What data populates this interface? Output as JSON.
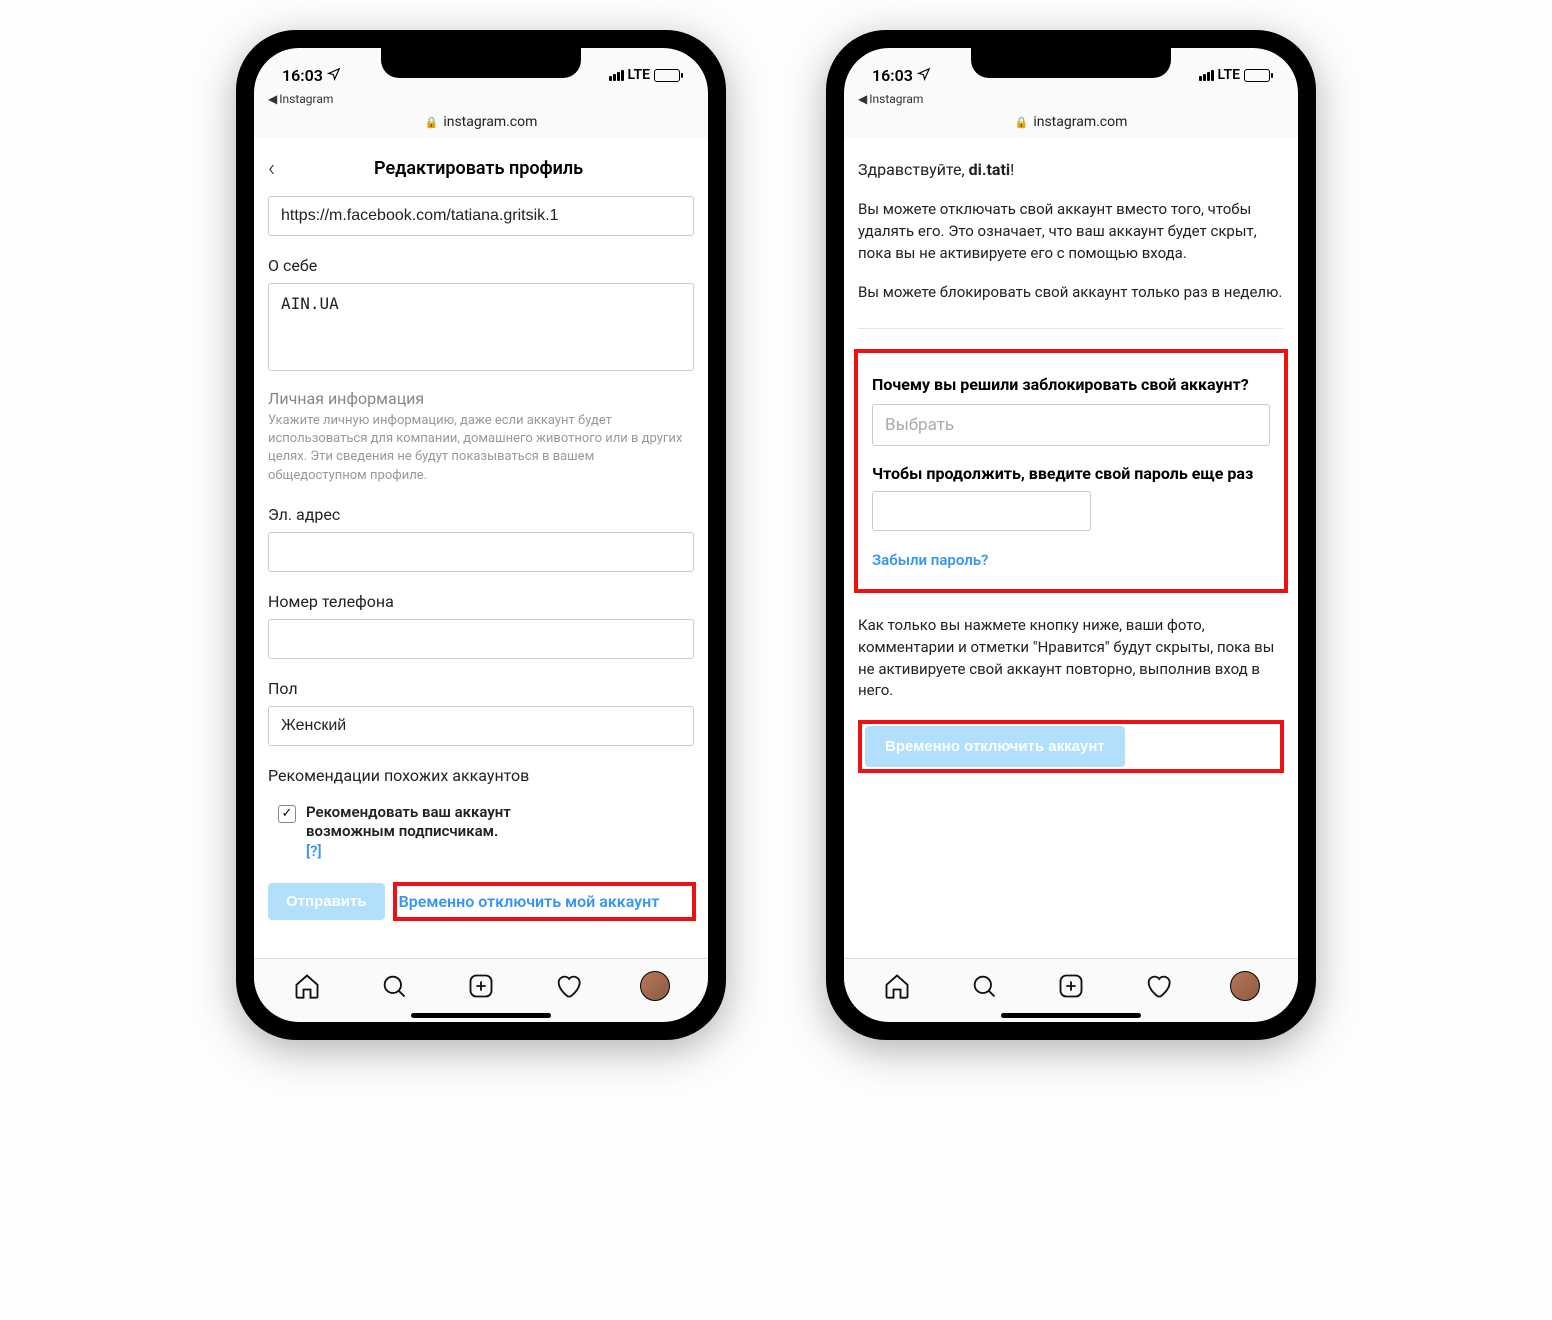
{
  "status": {
    "time": "16:03",
    "back_app": "Instagram",
    "carrier": "LTE",
    "url_host": "instagram.com"
  },
  "left": {
    "title": "Редактировать профиль",
    "website_value": "https://m.facebook.com/tatiana.gritsik.1",
    "bio_label": "О себе",
    "bio_value": "AIN.UA",
    "personal_title": "Личная информация",
    "personal_desc": "Укажите личную информацию, даже если аккаунт будет использоваться для компании, домашнего животного или в других целях. Эти сведения не будут показываться в вашем общедоступном профиле.",
    "email_label": "Эл. адрес",
    "phone_label": "Номер телефона",
    "gender_label": "Пол",
    "gender_value": "Женский",
    "similar_title": "Рекомендации похожих аккаунтов",
    "recommend_text": "Рекомендовать ваш аккаунт возможным подписчикам.",
    "recommend_hint": "[?]",
    "submit": "Отправить",
    "disable_link": "Временно отключить мой аккаунт"
  },
  "right": {
    "greeting_prefix": "Здравствуйте, ",
    "username": "di.tati",
    "greeting_suffix": "!",
    "para1": "Вы можете отключать свой аккаунт вместо того, чтобы удалять его. Это означает, что ваш аккаунт будет скрыт, пока вы не активируете его с помощью входа.",
    "para2": "Вы можете блокировать свой аккаунт только раз в неделю.",
    "reason_label": "Почему вы решили заблокировать свой аккаунт?",
    "reason_placeholder": "Выбрать",
    "password_label": "Чтобы продолжить, введите свой пароль еще раз",
    "forgot": "Забыли пароль?",
    "para3": "Как только вы нажмете кнопку ниже, ваши фото, комментарии и отметки \"Нравится\" будут скрыты, пока вы не активируете свой аккаунт повторно, выполнив вход в него.",
    "disable_btn": "Временно отключить аккаунт"
  }
}
